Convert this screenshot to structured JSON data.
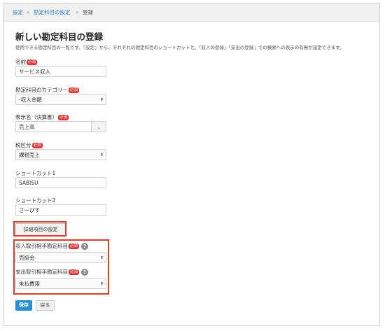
{
  "breadcrumb": {
    "items": [
      "設定",
      "勘定科目の設定",
      "登録"
    ],
    "separator": "»"
  },
  "title": "新しい勘定科目の登録",
  "description": "使用できる勘定科目の一覧です。「設定」から、それぞれの勘定科目のショートカットと、「収入の登録」「支出の登録」での検索への表示の有無が設定できます。",
  "required_badge": "必須",
  "help_mark": "?",
  "form": {
    "name": {
      "label": "名前",
      "value": "サービス収入"
    },
    "category": {
      "label": "勘定科目のカテゴリー",
      "value": "-収入金額"
    },
    "display_name": {
      "label": "表示名（決算書）",
      "value": "売上高"
    },
    "tax": {
      "label": "税区分",
      "value": "課税売上"
    },
    "shortcut1": {
      "label": "ショートカット1",
      "value": "SABISU"
    },
    "shortcut2": {
      "label": "ショートカット2",
      "value": "さーびす"
    },
    "detail_button": "詳細項目の設定",
    "income_counter": {
      "label": "収入取引相手勘定科目",
      "value": "売掛金"
    },
    "expense_counter": {
      "label": "支出取引相手勘定科目",
      "value": "未払費用"
    }
  },
  "actions": {
    "save": "保存",
    "back": "戻る"
  },
  "colors": {
    "accent": "#2a8fd0",
    "required": "#dd3333",
    "highlight": "#e03c2e",
    "link": "#2a7fc8"
  }
}
